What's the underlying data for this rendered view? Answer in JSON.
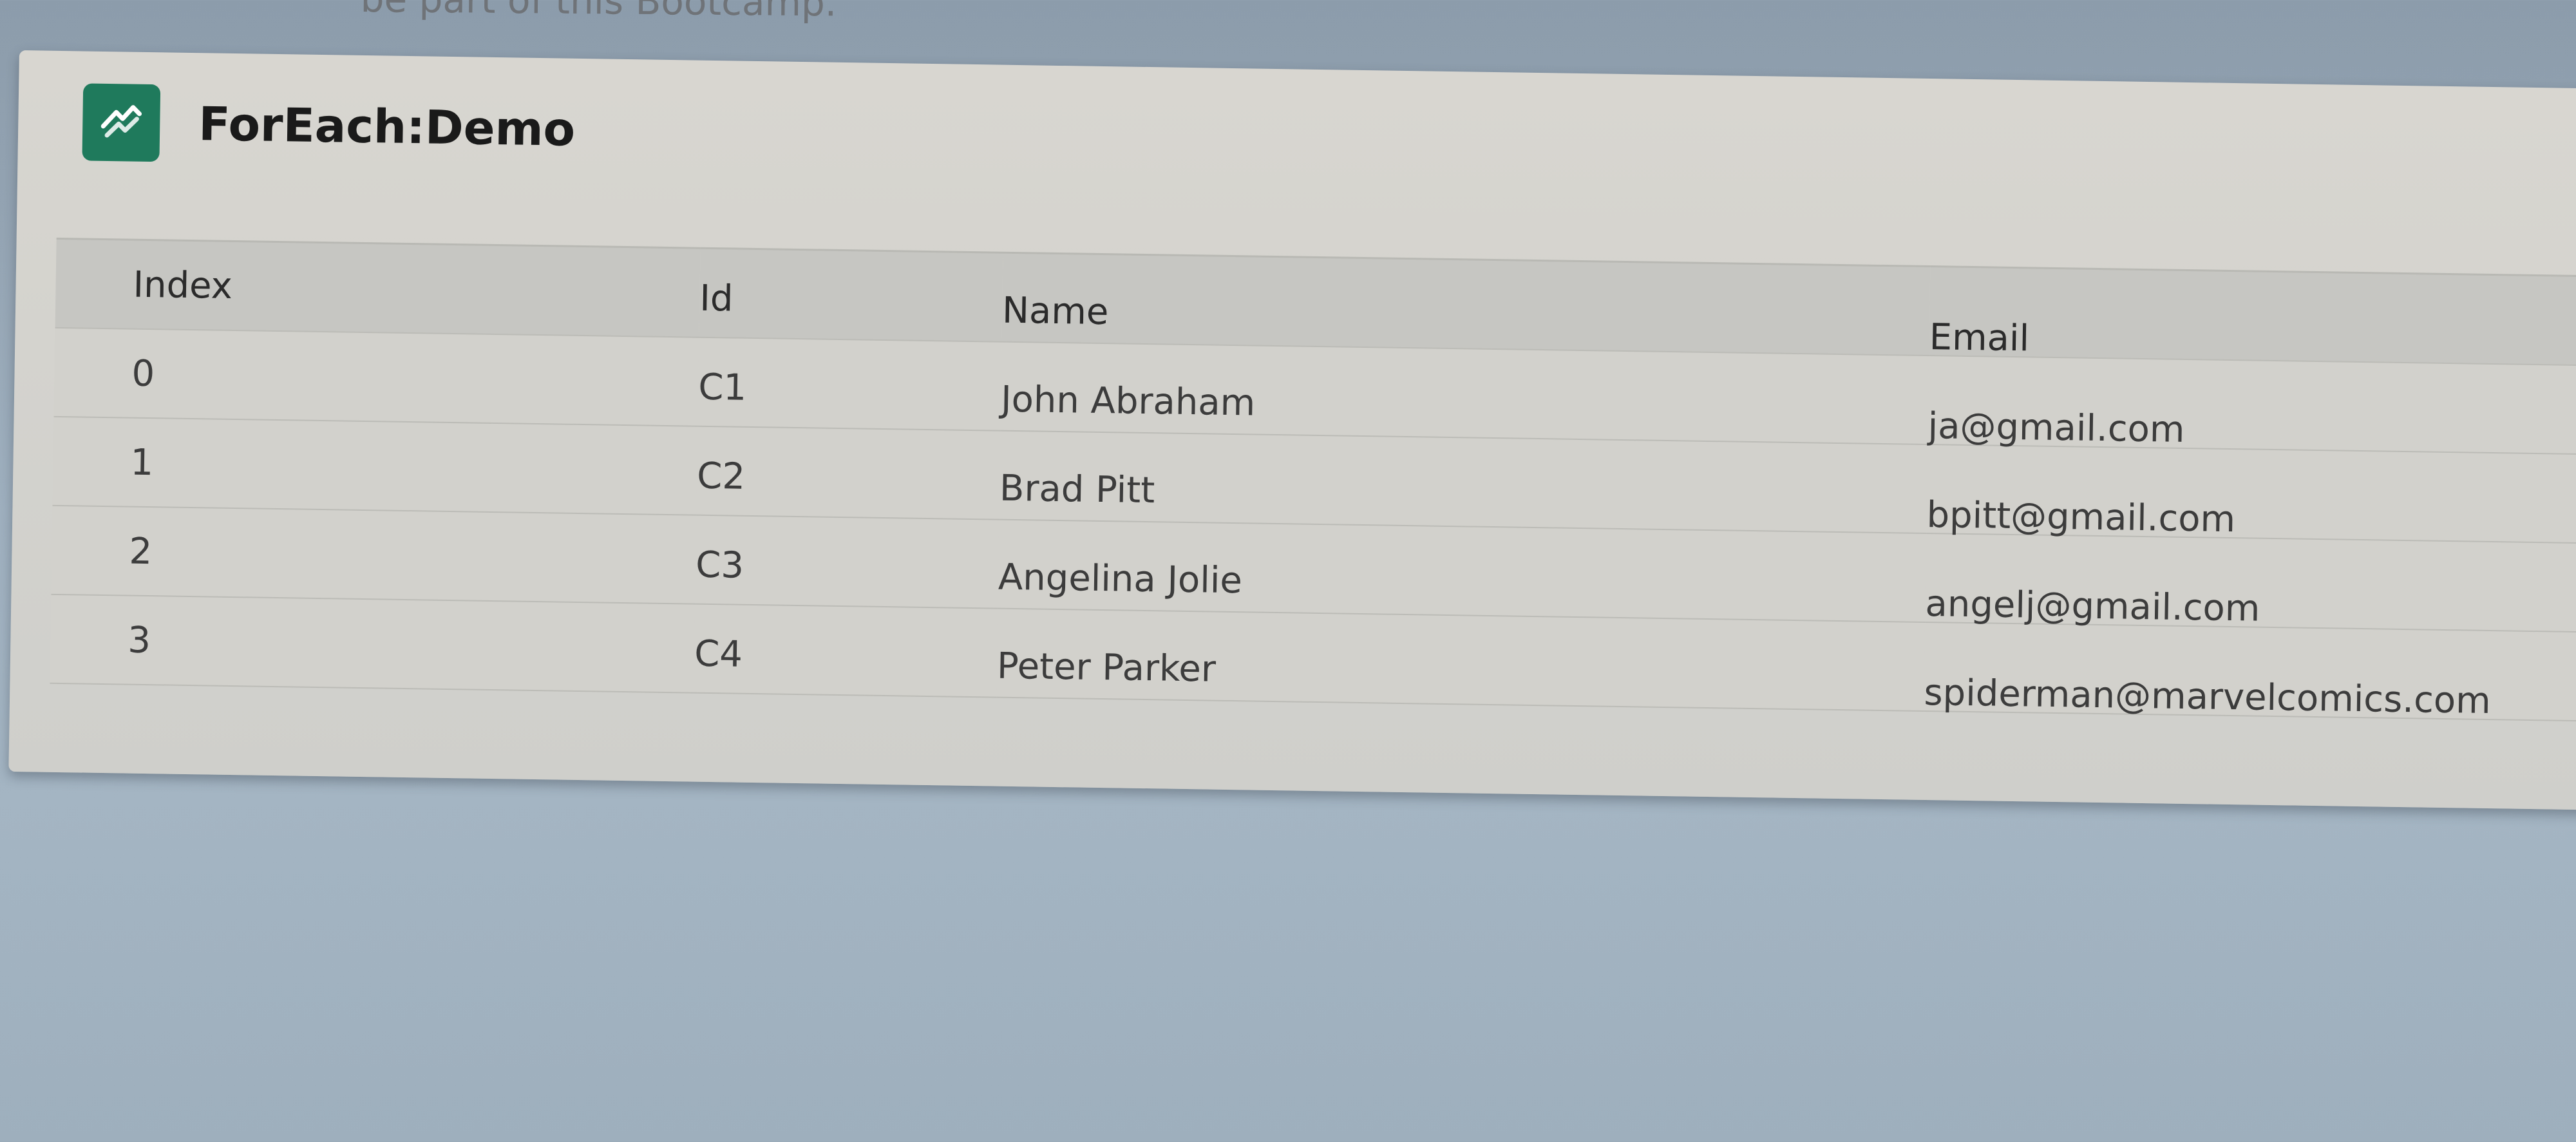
{
  "page": {
    "top_text": "be part of this Bootcamp."
  },
  "card": {
    "title": "ForEach:Demo",
    "icon": "lightning-component-icon",
    "icon_color": "#1f7a5c"
  },
  "table": {
    "headers": {
      "index": "Index",
      "id": "Id",
      "name": "Name",
      "email": "Email"
    },
    "rows": [
      {
        "index": "0",
        "id": "C1",
        "name": "John Abraham",
        "email": "ja@gmail.com"
      },
      {
        "index": "1",
        "id": "C2",
        "name": "Brad Pitt",
        "email": "bpitt@gmail.com"
      },
      {
        "index": "2",
        "id": "C3",
        "name": "Angelina Jolie",
        "email": "angelj@gmail.com"
      },
      {
        "index": "3",
        "id": "C4",
        "name": "Peter Parker",
        "email": "spiderman@marvelcomics.com"
      }
    ]
  }
}
